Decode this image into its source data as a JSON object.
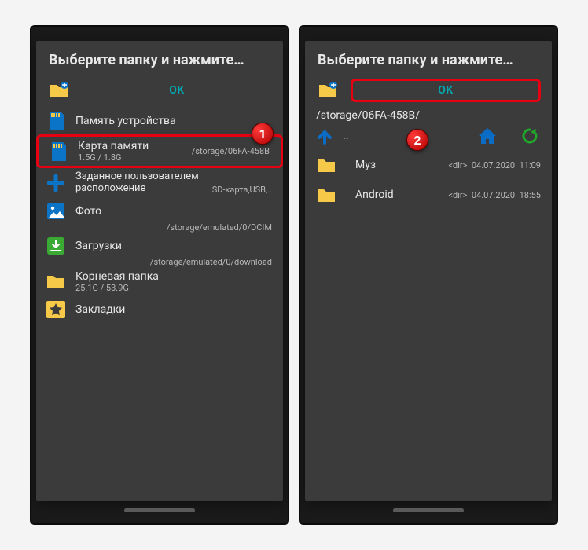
{
  "left": {
    "title": "Выберите папку и нажмите…",
    "ok": "OK",
    "items": [
      {
        "name": "Память устройства",
        "sub": "",
        "path": ""
      },
      {
        "name": "Карта памяти",
        "sub": "1.5G / 1.8G",
        "path": "/storage/06FA-458B"
      },
      {
        "name": "Заданное пользователем расположение",
        "sub": "",
        "path": "SD-карта,USB,.."
      },
      {
        "name": "Фото",
        "sub": "",
        "path": "/storage/emulated/0/DCIM"
      },
      {
        "name": "Загрузки",
        "sub": "",
        "path": "/storage/emulated/0/download"
      },
      {
        "name": "Корневая папка",
        "sub": "25.1G / 53.9G",
        "path": ""
      },
      {
        "name": "Закладки",
        "sub": "",
        "path": ""
      }
    ],
    "badge": "1"
  },
  "right": {
    "title": "Выберите папку и нажмите…",
    "ok": "OK",
    "path": "/storage/06FA-458B/",
    "up": "..",
    "folders": [
      {
        "name": "Муз",
        "type": "<dir>",
        "date": "04.07.2020",
        "time": "11:09"
      },
      {
        "name": "Android",
        "type": "<dir>",
        "date": "04.07.2020",
        "time": "18:55"
      }
    ],
    "badge": "2"
  }
}
